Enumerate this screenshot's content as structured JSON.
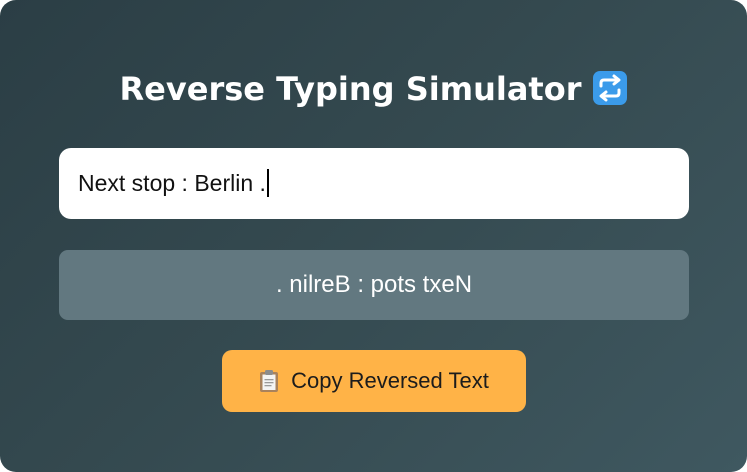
{
  "app": {
    "title": "Reverse Typing Simulator",
    "title_icon": "repeat-arrows-icon"
  },
  "input": {
    "value": "Next stop : Berlin ."
  },
  "output": {
    "value": ". nilreB : pots txeN"
  },
  "copy_button": {
    "label": "Copy Reversed Text",
    "icon": "clipboard-icon"
  },
  "colors": {
    "background_start": "#2b3e45",
    "background_end": "#3f5860",
    "output_box": "#627880",
    "button": "#ffb347",
    "title_icon": "#3b9bea"
  }
}
